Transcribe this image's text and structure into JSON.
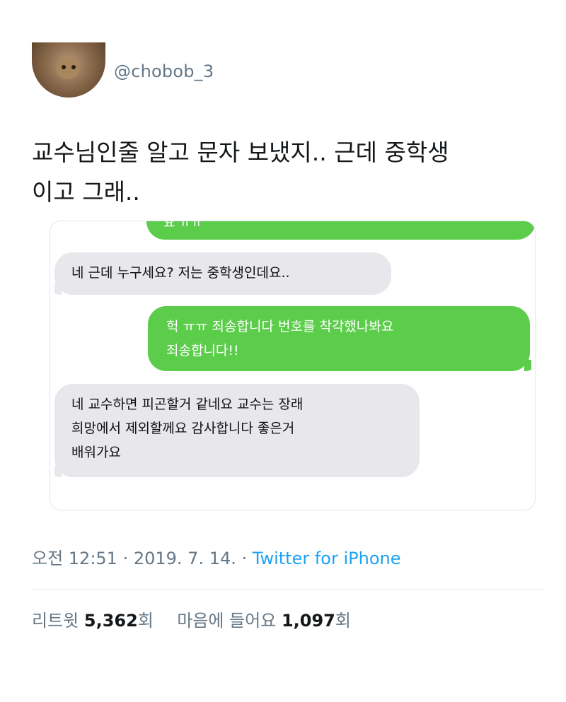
{
  "tweet": {
    "handle": "@chobob_3",
    "text_line1": "교수님인줄 알고 문자 보냈지.. 근데 중학생",
    "text_line2": "이고 그래..",
    "avatar_icon": "profile-avatar-hamster"
  },
  "screenshot": {
    "partial_top_text": "요 ㅠㅠ",
    "messages": [
      {
        "direction": "incoming",
        "lines": [
          "네 근데 누구세요? 저는 중학생인데요.."
        ]
      },
      {
        "direction": "outgoing",
        "lines": [
          "헉 ㅠㅠ 죄송합니다 번호를 착각했나봐요",
          "죄송합니다!!"
        ]
      },
      {
        "direction": "incoming",
        "lines": [
          "네 교수하면 피곤할거 같네요 교수는 장래",
          "희망에서 제외할께요 감사합니다 좋은거",
          "배워가요"
        ]
      }
    ],
    "colors": {
      "incoming": "#e7e7ec",
      "outgoing": "#5ccd4b"
    }
  },
  "meta": {
    "time": "오전 12:51",
    "sep1": " · ",
    "date": "2019. 7. 14.",
    "sep2": " · ",
    "source": "Twitter for iPhone"
  },
  "stats": {
    "retweet_label": "리트윗",
    "retweet_count": "5,362",
    "retweet_unit": "회",
    "like_label": "마음에 들어요",
    "like_count": "1,097",
    "like_unit": "회"
  }
}
